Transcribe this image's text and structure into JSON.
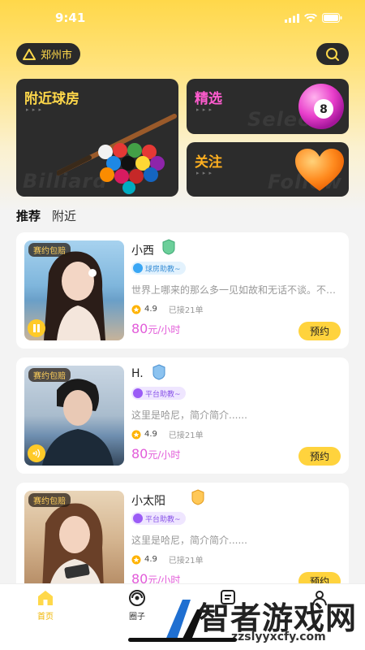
{
  "status_bar": {
    "time": "9:41"
  },
  "header": {
    "city": "郑州市"
  },
  "cards": {
    "billiard": {
      "title": "附近球房",
      "watermark": "Billiard Room",
      "arrows": "▸ ▸ ▸",
      "color": "#ffd84a"
    },
    "select": {
      "title": "精选",
      "watermark": "Select",
      "arrows": "▸ ▸ ▸",
      "color": "#ff5ccf"
    },
    "follow": {
      "title": "关注",
      "watermark": "Follow",
      "arrows": "▸ ▸ ▸",
      "color": "#ffb020"
    }
  },
  "tabs": [
    {
      "label": "推荐",
      "active": true
    },
    {
      "label": "附近",
      "active": false
    }
  ],
  "list": [
    {
      "promo": "赛约包赔",
      "name": "小西",
      "badge": "球房助教~",
      "badge_color": "#3aa7f5",
      "bio": "世界上哪来的那么多一见如故和无话不谈。不管…",
      "rating": "4.9",
      "orders": "已接21单",
      "price": "80",
      "unit": "元/小时",
      "book": "预约"
    },
    {
      "promo": "赛约包赔",
      "name": "H.",
      "badge": "平台助教~",
      "badge_color": "#9b5cf6",
      "bio": "这里是哈尼，简介简介......",
      "rating": "4.9",
      "orders": "已接21单",
      "price": "80",
      "unit": "元/小时",
      "book": "预约"
    },
    {
      "promo": "赛约包赔",
      "name": "小太阳",
      "badge": "平台助教~",
      "badge_color": "#9b5cf6",
      "bio": "这里是哈尼，简介简介......",
      "rating": "4.9",
      "orders": "已接21单",
      "price": "80",
      "unit": "元/小时",
      "book": "预约"
    }
  ],
  "tabbar": [
    {
      "label": "首页",
      "icon": "home-icon",
      "active": true
    },
    {
      "label": "圈子",
      "icon": "circle-icon",
      "active": false
    },
    {
      "label": "",
      "icon": "message-icon",
      "active": false
    },
    {
      "label": "",
      "icon": "profile-icon",
      "active": false
    }
  ],
  "watermark": {
    "title": "智者游戏网",
    "url": "zzslyyxcfy.com"
  }
}
